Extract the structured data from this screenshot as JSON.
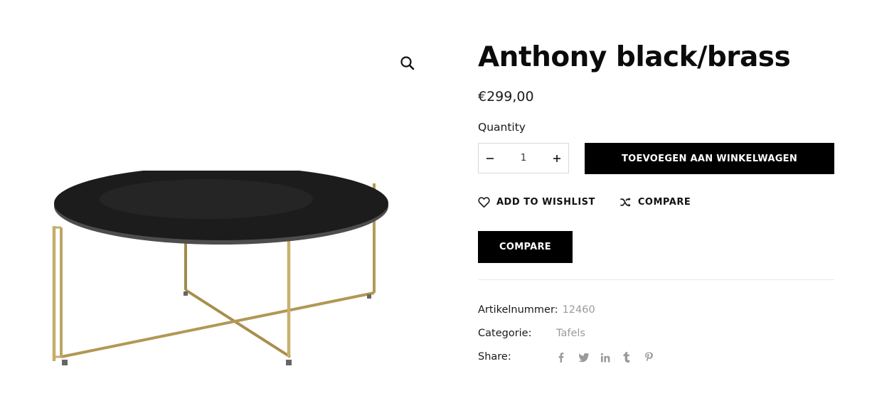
{
  "product": {
    "title": "Anthony black/brass",
    "price": "€299,00",
    "quantity_label": "Quantity",
    "quantity_value": "1",
    "add_to_cart_label": "TOEVOEGEN AAN WINKELWAGEN",
    "wishlist_label": "ADD TO WISHLIST",
    "compare_link_label": "COMPARE",
    "compare_button_label": "COMPARE",
    "sku_label": "Artikelnummer:",
    "sku_value": "12460",
    "category_label": "Categorie:",
    "category_value": "Tafels",
    "share_label": "Share:"
  },
  "icons": {
    "zoom": "magnifier-icon",
    "minus": "minus-icon",
    "plus": "plus-icon",
    "wishlist": "heart-icon",
    "compare": "shuffle-icon",
    "share": [
      "facebook-icon",
      "twitter-icon",
      "linkedin-icon",
      "tumblr-icon",
      "pinterest-icon"
    ]
  },
  "colors": {
    "button_bg": "#000000",
    "button_text": "#ffffff",
    "muted_text": "#9a9a9a",
    "divider": "#e7e7e7"
  }
}
